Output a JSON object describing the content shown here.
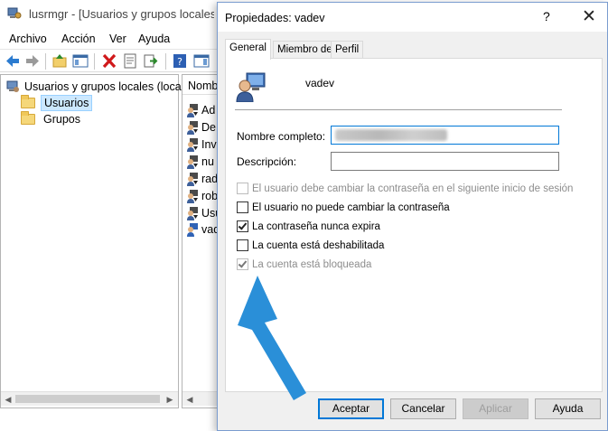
{
  "background_window": {
    "title": "lusrmgr - [Usuarios y grupos locales (lo",
    "menu": [
      "Archivo",
      "Acción",
      "Ver",
      "Ayuda"
    ],
    "tree": {
      "root_label": "Usuarios y grupos locales (local)",
      "items": [
        {
          "label": "Usuarios",
          "selected": true
        },
        {
          "label": "Grupos",
          "selected": false
        }
      ]
    },
    "list": {
      "header": "Nomb",
      "rows": [
        "Ad",
        "De",
        "Inv",
        "nu",
        "rad",
        "rob",
        "Usu",
        "vad"
      ]
    }
  },
  "dialog": {
    "title": "Propiedades: vadev",
    "help_glyph": "?",
    "close_glyph": "✕",
    "tabs": [
      {
        "label": "General",
        "active": true
      },
      {
        "label": "Miembro de",
        "active": false
      },
      {
        "label": "Perfil",
        "active": false
      }
    ],
    "username": "vadev",
    "fields": {
      "full_name_label": "Nombre completo:",
      "description_label": "Descripción:",
      "description_value": ""
    },
    "checkboxes": [
      {
        "label": "El usuario debe cambiar la contraseña en el siguiente inicio de sesión",
        "checked": false,
        "disabled": true
      },
      {
        "label": "El usuario no puede cambiar la contraseña",
        "checked": false,
        "disabled": false
      },
      {
        "label": "La contraseña nunca expira",
        "checked": true,
        "disabled": false
      },
      {
        "label": "La cuenta está deshabilitada",
        "checked": false,
        "disabled": false
      },
      {
        "label": "La cuenta está bloqueada",
        "checked": true,
        "disabled": true
      }
    ],
    "buttons": {
      "ok": "Aceptar",
      "cancel": "Cancelar",
      "apply": "Aplicar",
      "help": "Ayuda"
    }
  },
  "colors": {
    "accent": "#0078d7",
    "annotation_arrow": "#2a8fd8",
    "selection": "#cce8ff"
  }
}
